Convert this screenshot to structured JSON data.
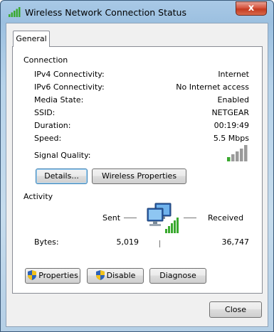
{
  "window": {
    "title": "Wireless Network Connection Status",
    "close_glyph": "x"
  },
  "tabs": [
    {
      "label": "General",
      "selected": true
    }
  ],
  "connection": {
    "header": "Connection",
    "rows": [
      {
        "label": "IPv4 Connectivity:",
        "value": "Internet"
      },
      {
        "label": "IPv6 Connectivity:",
        "value": "No Internet access"
      },
      {
        "label": "Media State:",
        "value": "Enabled"
      },
      {
        "label": "SSID:",
        "value": "NETGEAR"
      },
      {
        "label": "Duration:",
        "value": "00:19:49"
      },
      {
        "label": "Speed:",
        "value": "5.5 Mbps"
      }
    ],
    "signal_label": "Signal Quality:",
    "signal_bars_lit": 1,
    "signal_bars_total": 5,
    "details_button": "Details...",
    "wireless_properties_button": "Wireless Properties"
  },
  "activity": {
    "header": "Activity",
    "sent_label": "Sent",
    "received_label": "Received",
    "bytes_label": "Bytes:",
    "bytes_sent": "5,019",
    "bytes_received": "36,747"
  },
  "actions": {
    "properties_button": "Properties",
    "disable_button": "Disable",
    "diagnose_button": "Diagnose"
  },
  "footer": {
    "close_button": "Close"
  },
  "icons": {
    "title": "wireless-signal-icon",
    "activity": "network-computers-icon",
    "shield": "uac-shield-icon"
  },
  "colors": {
    "signal_green": "#3aa92f",
    "signal_gray": "#9a9a9a",
    "close_red": "#c43a20"
  }
}
